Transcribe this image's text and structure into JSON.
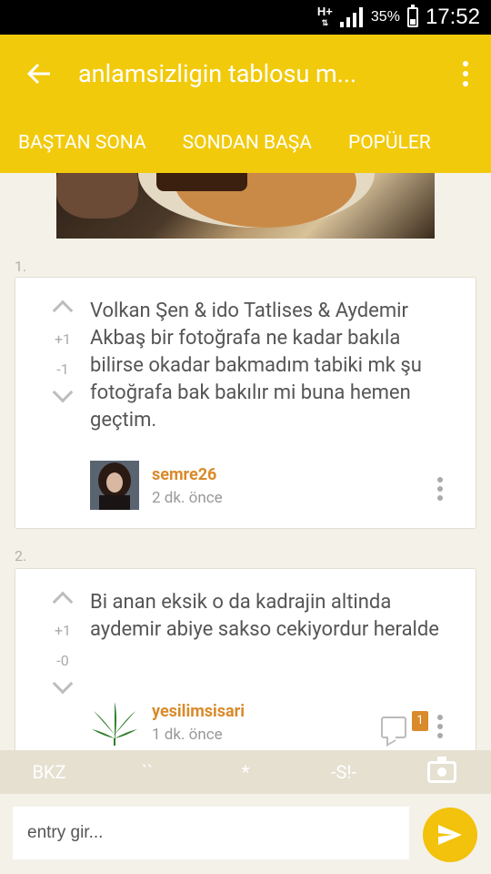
{
  "status": {
    "network": "H+",
    "battery": "35%",
    "battery_level": 0.35,
    "time": "17:52"
  },
  "appbar": {
    "back_icon": "arrow-left-icon",
    "title": "anlamsizligin tablosu m...",
    "menu_icon": "vertical-dots-icon"
  },
  "tabs": [
    {
      "label": "BAŞTAN SONA"
    },
    {
      "label": "SONDAN BAŞA"
    },
    {
      "label": "POPÜLER"
    }
  ],
  "entries": [
    {
      "num": "1.",
      "upvotes": "+1",
      "downvotes": "-1",
      "text": "Volkan Şen & ido Tatlises & Aydemir Akbaş bir fotoğrafa ne kadar bakıla bilirse okadar bakmadım tabiki mk şu fotoğrafa bak bakılır mi buna hemen geçtim.",
      "author": "semre26",
      "time": "2 dk. önce"
    },
    {
      "num": "2.",
      "upvotes": "+1",
      "downvotes": "-0",
      "text": "Bi anan eksik o da kadrajin altinda aydemir abiye sakso cekiyordur heralde",
      "author": "yesilimsisari",
      "time": "1 dk. önce",
      "comments": "1"
    }
  ],
  "toolbar": {
    "bkz": "BKZ",
    "backtick": "``",
    "star": "*",
    "spoiler": "-S!-",
    "camera_icon": "camera-icon"
  },
  "composer": {
    "placeholder": "entry gir...",
    "send_icon": "send-icon"
  },
  "colors": {
    "accent": "#f2ca0c",
    "author": "#d98a2a"
  }
}
